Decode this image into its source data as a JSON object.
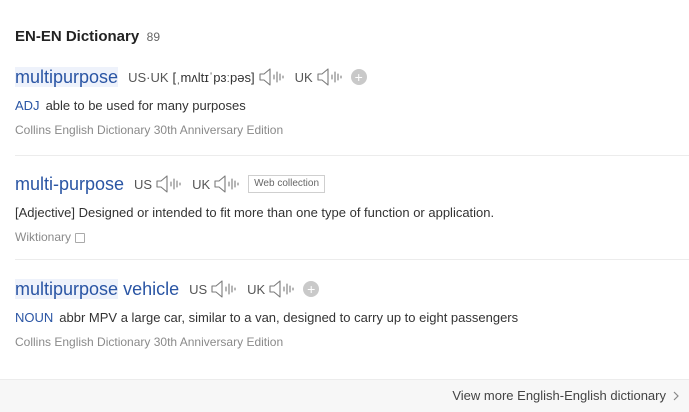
{
  "header": {
    "title": "EN-EN Dictionary",
    "count": "89"
  },
  "entries": [
    {
      "word_highlight": "multipurpose",
      "word_rest": "",
      "labels": {
        "us_uk": "US·UK",
        "uk": "UK"
      },
      "ipa": "[ˌmʌltɪˈpɜːpəs]",
      "pos": "ADJ",
      "definition": "able to be used for many purposes",
      "source": "Collins English Dictionary 30th Anniversary Edition"
    },
    {
      "word": "multi-purpose",
      "labels": {
        "us": "US",
        "uk": "UK"
      },
      "tag": "Web collection",
      "definition": "[Adjective] Designed or intended to fit more than one type of function or application.",
      "source": "Wiktionary"
    },
    {
      "word_highlight": "multipurpose",
      "word_rest": " vehicle",
      "labels": {
        "us": "US",
        "uk": "UK"
      },
      "pos": "NOUN",
      "definition": "abbr MPV a large car, similar to a van, designed to carry up to eight passengers",
      "source": "Collins English Dictionary 30th Anniversary Edition"
    }
  ],
  "footer": {
    "view_more": "View more English-English dictionary"
  },
  "icons": {
    "speaker": "speaker-icon",
    "add": "add-icon",
    "copy": "copy-icon",
    "chevron": "chevron-right-icon"
  },
  "colors": {
    "link": "#2a55a4",
    "highlight": "#eef2fb"
  }
}
